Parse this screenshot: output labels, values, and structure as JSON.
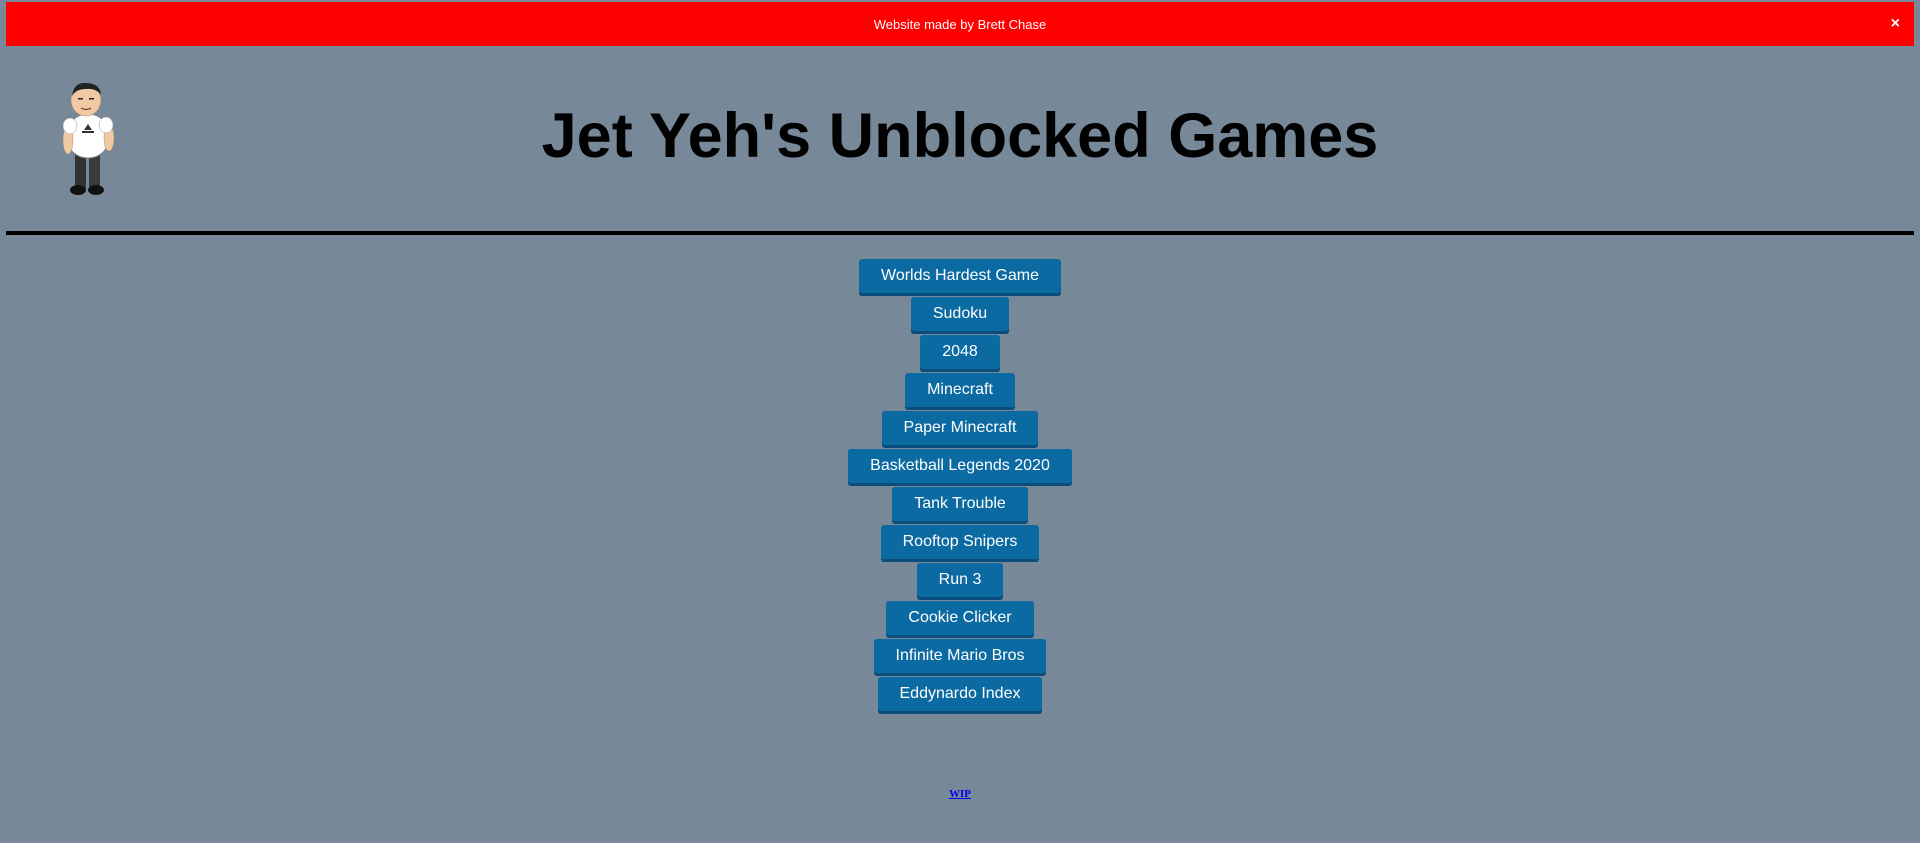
{
  "banner": {
    "text": "Website made by Brett Chase",
    "close_label": "×",
    "color": "#ff0000"
  },
  "header": {
    "title": "Jet Yeh's Unblocked Games",
    "mascot_icon": "cartoon-man-icon"
  },
  "games": [
    {
      "label": "Worlds Hardest Game"
    },
    {
      "label": "Sudoku"
    },
    {
      "label": "2048"
    },
    {
      "label": "Minecraft"
    },
    {
      "label": "Paper Minecraft"
    },
    {
      "label": "Basketball Legends 2020"
    },
    {
      "label": "Tank Trouble"
    },
    {
      "label": "Rooftop Snipers"
    },
    {
      "label": "Run 3"
    },
    {
      "label": "Cookie Clicker"
    },
    {
      "label": "Infinite Mario Bros"
    },
    {
      "label": "Eddynardo Index"
    }
  ],
  "footer": {
    "link_label": "WIP"
  },
  "colors": {
    "background": "#778899",
    "button": "#0a6aa1",
    "link": "#0000ee"
  }
}
